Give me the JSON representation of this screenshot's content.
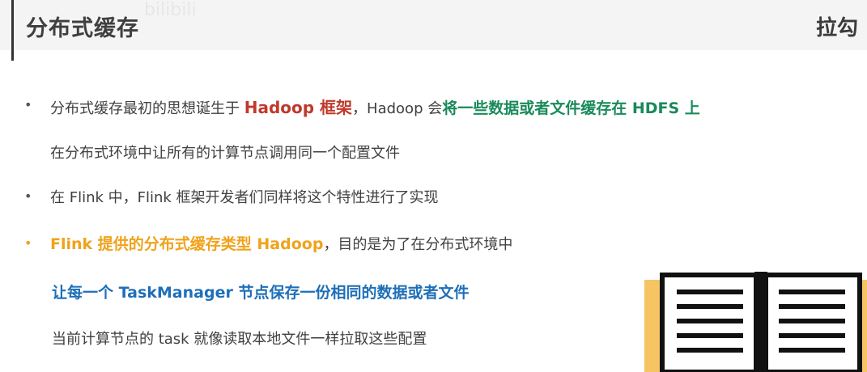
{
  "header": {
    "title": "分布式缓存",
    "watermark": "bilibili",
    "logo": "拉勾"
  },
  "bullets": {
    "b1": {
      "part1": "分布式缓存最初的思想诞生于 ",
      "part2": "Hadoop 框架",
      "part3": "，Hadoop 会",
      "part4": "将一些数据或者文件缓存在 HDFS 上",
      "line2": "在分布式环境中让所有的计算节点调用同一个配置文件"
    },
    "b2": {
      "text": "在 Flink 中，Flink 框架开发者们同样将这个特性进行了实现"
    },
    "b3": {
      "part1": "Flink 提供的分布式缓存类型 Hadoop",
      "part2": "，目的是为了在分布式环境中",
      "line2": "让每一个 TaskManager 节点保存一份相同的数据或者文件",
      "line3": "当前计算节点的 task 就像读取本地文件一样拉取这些配置"
    },
    "bullet_symbol": "•"
  },
  "colors": {
    "red": "#c0392b",
    "green": "#1a8a5a",
    "orange": "#f0a21a",
    "blue": "#1e6fb8",
    "book_fill": "#f5c563"
  }
}
